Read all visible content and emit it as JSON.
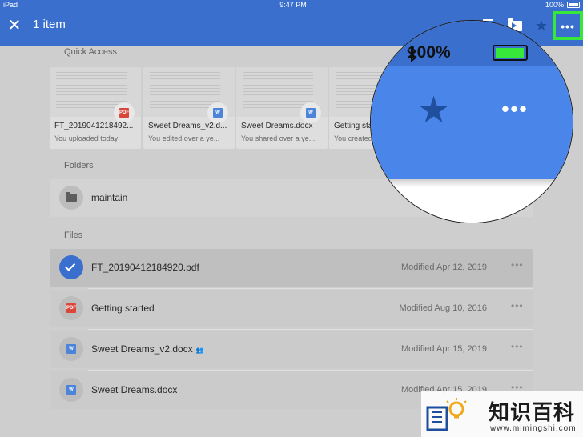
{
  "status_bar": {
    "device": "iPad",
    "time": "9:47 PM",
    "battery": "100%"
  },
  "app_bar": {
    "title": "1 item",
    "actions": [
      "close-icon",
      "trash-icon",
      "move-icon",
      "star-icon",
      "more-icon"
    ]
  },
  "quick_access": {
    "label": "Quick Access",
    "cards": [
      {
        "name": "FT_2019041218492...",
        "sub": "You uploaded today",
        "type": "PDF"
      },
      {
        "name": "Sweet Dreams_v2.d...",
        "sub": "You edited over a ye...",
        "type": "W"
      },
      {
        "name": "Sweet Dreams.docx",
        "sub": "You shared over a ye...",
        "type": "W"
      },
      {
        "name": "Getting sta",
        "sub": "You created",
        "type": "PDF"
      }
    ]
  },
  "folders": {
    "label": "Folders",
    "items": [
      {
        "name": "maintain"
      }
    ]
  },
  "files": {
    "label": "Files",
    "rows": [
      {
        "name": "FT_20190412184920.pdf",
        "modified": "Modified Apr 12, 2019",
        "type": "check"
      },
      {
        "name": "Getting started",
        "modified": "Modified Aug 10, 2016",
        "type": "PDF"
      },
      {
        "name": "Sweet Dreams_v2.docx",
        "modified": "Modified Apr 15, 2019",
        "type": "W"
      },
      {
        "name": "Sweet Dreams.docx",
        "modified": "Modified Apr 15, 2019",
        "type": "W"
      }
    ]
  },
  "magnifier": {
    "battery": "100%"
  },
  "watermark": {
    "title": "知识百科",
    "url": "www.mimingshi.com"
  },
  "colors": {
    "app_bar": "#3a6fce",
    "highlight": "#37e83a",
    "pdf": "#d9463a",
    "word": "#4b84d8"
  }
}
